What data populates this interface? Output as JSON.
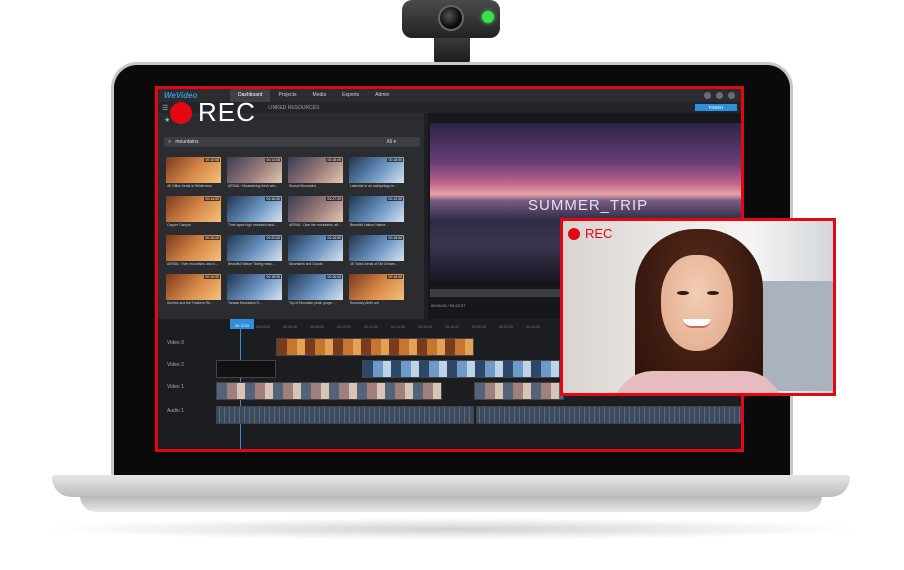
{
  "app": {
    "logo": "WeVideo",
    "menu": [
      "Dashboard",
      "Projects",
      "Media",
      "Exports",
      "Admin"
    ],
    "active_menu": "Dashboard",
    "linked_resources": "LINKED RESOURCES",
    "finish_label": "FINISH"
  },
  "search": {
    "value": "mountains",
    "filter": "All ▾"
  },
  "clips": [
    {
      "duration": "00:10:06",
      "caption": "4K Office Aerial of Wilderness",
      "tone": "warm"
    },
    {
      "duration": "00:14:08",
      "caption": "AERIAL: Mountaining fresh sen...",
      "tone": "mix"
    },
    {
      "duration": "00:18:00",
      "caption": "Sunset Mountains",
      "tone": "mix"
    },
    {
      "duration": "00:18:00",
      "caption": "Lakeside in an archipelago in...",
      "tone": "cool"
    },
    {
      "duration": "00:14:00",
      "caption": "Copper Canyon",
      "tone": "warm"
    },
    {
      "duration": "00:16:00",
      "caption": "Time lapse high mountain land...",
      "tone": "cool"
    },
    {
      "duration": "00:27:00",
      "caption": "AERIAL: Over the mountains, aff...",
      "tone": "mix"
    },
    {
      "duration": "00:12:00",
      "caption": "Beautiful Nature Nature...",
      "tone": "cool"
    },
    {
      "duration": "00:16:00",
      "caption": "AERIAL: Over mountains and cl...",
      "tone": "warm"
    },
    {
      "duration": "00:22:00",
      "caption": "Beautiful Nature Tatreg ranks...",
      "tone": "cool"
    },
    {
      "duration": "00:14:00",
      "caption": "Mountains and Clouds",
      "tone": "cool"
    },
    {
      "duration": "00:16:00",
      "caption": "4K Video Aerial of Tall Cedars...",
      "tone": "cool"
    },
    {
      "duration": "00:16:00",
      "caption": "Sunrise and the Trekkers Re...",
      "tone": "warm"
    },
    {
      "duration": "00:18:00",
      "caption": "Tarawa Mountains S...",
      "tone": "cool"
    },
    {
      "duration": "00:16:00",
      "caption": "Top of Mountain peak, gorge...",
      "tone": "cool"
    },
    {
      "duration": "00:16:00",
      "caption": "Summary Ainth ant",
      "tone": "warm"
    }
  ],
  "preview": {
    "title": "SUMMER_TRIP",
    "time": "00:00:02 / 00:22:07"
  },
  "timeline": {
    "playhead": "00:02:03",
    "ticks": [
      "00:04:00",
      "00:06:00",
      "00:08:00",
      "00:10:00",
      "00:12:00",
      "00:14:00",
      "00:16:00",
      "00:18:00",
      "00:20:00",
      "00:22:00",
      "00:24:00"
    ],
    "tracks": [
      "Video 3",
      "Video 2",
      "Video 1",
      "Audio 1"
    ]
  },
  "rec": {
    "main_label": "REC",
    "overlay_label": "REC"
  },
  "colors": {
    "rec_red": "#e30613",
    "accent_blue": "#2f8fdc",
    "led_green": "#39e24a"
  }
}
